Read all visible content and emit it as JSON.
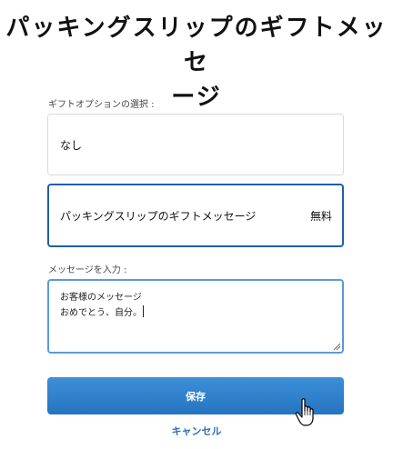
{
  "title_line1": "パッキングスリップのギフトメッセ",
  "title_line2": "ージ",
  "gift_option_label": "ギフトオプションの選択 :",
  "options": [
    {
      "label": "なし",
      "price": ""
    },
    {
      "label": "パッキングスリップのギフトメッセージ",
      "price": "無料"
    }
  ],
  "selected_option_index": 1,
  "message_label": "メッセージを入力 :",
  "message_lines": [
    "お客様のメッセージ",
    "おめでとう、自分。"
  ],
  "save_label": "保存",
  "cancel_label": "キャンセル",
  "colors": {
    "accent": "#2574bf",
    "selected_border": "#1f5fa8",
    "link": "#2a6fb8"
  }
}
